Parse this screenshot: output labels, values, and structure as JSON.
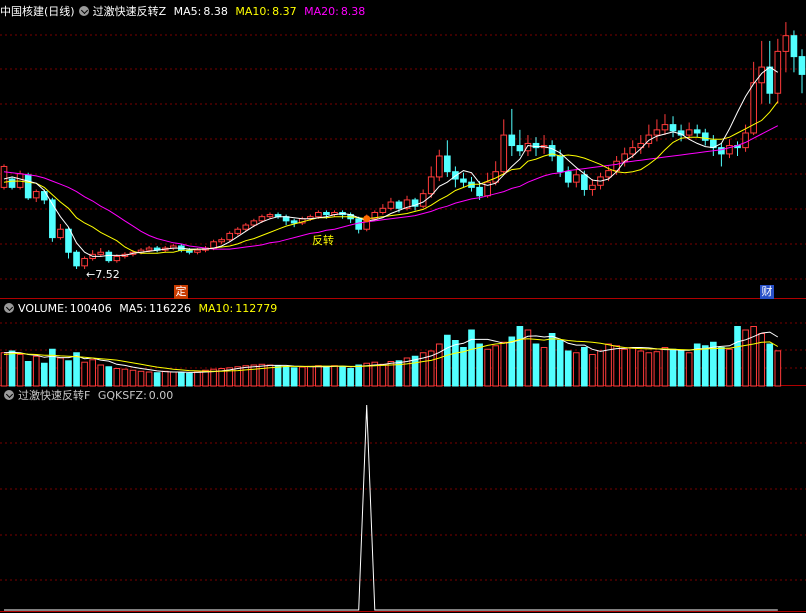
{
  "main_header": {
    "stock": "中国核建",
    "period": "(日线)",
    "indicator": "过激快速反转Z",
    "ma5_label": "MA5:",
    "ma5_value": "8.38",
    "ma10_label": "MA10:",
    "ma10_value": "8.37",
    "ma20_label": "MA20:",
    "ma20_value": "8.38"
  },
  "volume_header": {
    "name": "VOLUME:",
    "value": "100406",
    "ma5_label": "MA5:",
    "ma5_value": "116226",
    "ma10_label": "MA10:",
    "ma10_value": "112779"
  },
  "indicator_header": {
    "name": "过激快速反转F",
    "series": "GQKSFZ:",
    "value": "0.00"
  },
  "annotations": {
    "low_label": "←7.52",
    "signal_label": "反转",
    "tag_left": "定",
    "tag_right": "财"
  },
  "colors": {
    "up": "#ff3b3b",
    "down": "#52ffff",
    "ma5": "#ffffff",
    "ma10": "#ffff00",
    "ma20": "#ff00ff",
    "grid": "#7a0000",
    "separator": "#b00000"
  },
  "chart_data": [
    {
      "type": "candlestick",
      "title": "中国核建 (日线)",
      "ylim": [
        7.3,
        9.9
      ],
      "grid": true,
      "candles": [
        [
          8.3,
          8.5,
          8.28,
          8.52
        ],
        [
          8.38,
          8.3,
          8.28,
          8.4
        ],
        [
          8.3,
          8.43,
          8.28,
          8.46
        ],
        [
          8.42,
          8.2,
          8.18,
          8.44
        ],
        [
          8.2,
          8.26,
          8.16,
          8.28
        ],
        [
          8.26,
          8.18,
          8.14,
          8.28
        ],
        [
          8.18,
          7.82,
          7.78,
          8.2
        ],
        [
          7.82,
          7.9,
          7.8,
          7.95
        ],
        [
          7.9,
          7.68,
          7.62,
          7.92
        ],
        [
          7.68,
          7.55,
          7.52,
          7.7
        ],
        [
          7.55,
          7.62,
          7.52,
          7.64
        ],
        [
          7.62,
          7.66,
          7.6,
          7.7
        ],
        [
          7.66,
          7.68,
          7.64,
          7.72
        ],
        [
          7.68,
          7.6,
          7.58,
          7.7
        ],
        [
          7.6,
          7.64,
          7.58,
          7.66
        ],
        [
          7.64,
          7.66,
          7.62,
          7.68
        ],
        [
          7.66,
          7.68,
          7.64,
          7.7
        ],
        [
          7.68,
          7.7,
          7.66,
          7.72
        ],
        [
          7.7,
          7.72,
          7.68,
          7.74
        ],
        [
          7.72,
          7.7,
          7.68,
          7.74
        ],
        [
          7.7,
          7.72,
          7.68,
          7.74
        ],
        [
          7.72,
          7.74,
          7.7,
          7.76
        ],
        [
          7.74,
          7.7,
          7.68,
          7.76
        ],
        [
          7.7,
          7.68,
          7.66,
          7.72
        ],
        [
          7.68,
          7.7,
          7.66,
          7.72
        ],
        [
          7.7,
          7.72,
          7.68,
          7.74
        ],
        [
          7.72,
          7.78,
          7.7,
          7.8
        ],
        [
          7.78,
          7.8,
          7.76,
          7.82
        ],
        [
          7.8,
          7.86,
          7.78,
          7.88
        ],
        [
          7.86,
          7.9,
          7.84,
          7.92
        ],
        [
          7.9,
          7.94,
          7.88,
          7.96
        ],
        [
          7.94,
          7.98,
          7.92,
          8.0
        ],
        [
          7.98,
          8.02,
          7.96,
          8.04
        ],
        [
          8.02,
          8.04,
          8.0,
          8.06
        ],
        [
          8.04,
          8.02,
          8.0,
          8.06
        ],
        [
          8.02,
          7.98,
          7.94,
          8.04
        ],
        [
          7.98,
          7.96,
          7.92,
          8.0
        ],
        [
          7.96,
          8.0,
          7.94,
          8.02
        ],
        [
          8.0,
          8.02,
          7.98,
          8.04
        ],
        [
          8.02,
          8.06,
          8.0,
          8.08
        ],
        [
          8.06,
          8.04,
          8.0,
          8.08
        ],
        [
          8.04,
          8.06,
          8.02,
          8.08
        ],
        [
          8.06,
          8.04,
          8.0,
          8.08
        ],
        [
          8.04,
          8.0,
          7.96,
          8.06
        ],
        [
          8.0,
          7.9,
          7.86,
          8.02
        ],
        [
          7.9,
          8.0,
          7.88,
          8.04
        ],
        [
          8.0,
          8.06,
          7.98,
          8.08
        ],
        [
          8.06,
          8.1,
          8.04,
          8.14
        ],
        [
          8.1,
          8.16,
          8.08,
          8.2
        ],
        [
          8.16,
          8.1,
          8.06,
          8.18
        ],
        [
          8.1,
          8.18,
          8.08,
          8.22
        ],
        [
          8.18,
          8.12,
          8.08,
          8.2
        ],
        [
          8.12,
          8.24,
          8.1,
          8.28
        ],
        [
          8.24,
          8.4,
          8.2,
          8.5
        ],
        [
          8.4,
          8.6,
          8.36,
          8.66
        ],
        [
          8.6,
          8.45,
          8.4,
          8.75
        ],
        [
          8.45,
          8.38,
          8.3,
          8.5
        ],
        [
          8.38,
          8.35,
          8.3,
          8.44
        ],
        [
          8.35,
          8.3,
          8.26,
          8.4
        ],
        [
          8.3,
          8.22,
          8.18,
          8.36
        ],
        [
          8.22,
          8.35,
          8.2,
          8.44
        ],
        [
          8.35,
          8.45,
          8.32,
          8.55
        ],
        [
          8.45,
          8.8,
          8.42,
          8.95
        ],
        [
          8.8,
          8.7,
          8.6,
          9.05
        ],
        [
          8.7,
          8.65,
          8.6,
          8.85
        ],
        [
          8.65,
          8.72,
          8.6,
          8.8
        ],
        [
          8.72,
          8.68,
          8.6,
          8.78
        ],
        [
          8.68,
          8.7,
          8.62,
          8.8
        ],
        [
          8.7,
          8.6,
          8.55,
          8.75
        ],
        [
          8.6,
          8.45,
          8.4,
          8.66
        ],
        [
          8.45,
          8.35,
          8.3,
          8.5
        ],
        [
          8.35,
          8.42,
          8.3,
          8.48
        ],
        [
          8.42,
          8.28,
          8.22,
          8.46
        ],
        [
          8.28,
          8.32,
          8.22,
          8.38
        ],
        [
          8.32,
          8.4,
          8.28,
          8.44
        ],
        [
          8.4,
          8.46,
          8.36,
          8.5
        ],
        [
          8.46,
          8.55,
          8.42,
          8.6
        ],
        [
          8.55,
          8.62,
          8.5,
          8.68
        ],
        [
          8.62,
          8.68,
          8.58,
          8.75
        ],
        [
          8.68,
          8.72,
          8.62,
          8.8
        ],
        [
          8.72,
          8.8,
          8.68,
          8.9
        ],
        [
          8.8,
          8.85,
          8.74,
          8.95
        ],
        [
          8.85,
          8.9,
          8.8,
          9.0
        ],
        [
          8.9,
          8.84,
          8.78,
          8.98
        ],
        [
          8.84,
          8.8,
          8.74,
          8.9
        ],
        [
          8.8,
          8.85,
          8.76,
          8.92
        ],
        [
          8.85,
          8.82,
          8.78,
          8.9
        ],
        [
          8.82,
          8.75,
          8.7,
          8.86
        ],
        [
          8.75,
          8.68,
          8.6,
          8.8
        ],
        [
          8.68,
          8.62,
          8.5,
          8.72
        ],
        [
          8.62,
          8.7,
          8.58,
          8.76
        ],
        [
          8.7,
          8.68,
          8.6,
          8.74
        ],
        [
          8.68,
          8.82,
          8.64,
          8.9
        ],
        [
          8.82,
          9.3,
          8.8,
          9.5
        ],
        [
          9.3,
          9.45,
          9.1,
          9.7
        ],
        [
          9.45,
          9.2,
          9.1,
          9.7
        ],
        [
          9.2,
          9.6,
          9.1,
          9.72
        ],
        [
          9.6,
          9.75,
          9.4,
          9.88
        ],
        [
          9.75,
          9.55,
          9.4,
          9.8
        ],
        [
          9.55,
          9.38,
          9.2,
          9.62
        ]
      ],
      "ma5": [
        8.38,
        8.4,
        8.38,
        8.36,
        8.34,
        8.27,
        8.14,
        8.02,
        7.92,
        7.77,
        7.68,
        7.64,
        7.64,
        7.65,
        7.65,
        7.65,
        7.67,
        7.68,
        7.69,
        7.7,
        7.71,
        7.72,
        7.72,
        7.71,
        7.71,
        7.71,
        7.72,
        7.74,
        7.78,
        7.83,
        7.88,
        7.93,
        7.97,
        8.0,
        8.02,
        8.02,
        8.01,
        8.0,
        8.0,
        8.01,
        8.02,
        8.04,
        8.05,
        8.04,
        8.01,
        7.98,
        7.99,
        8.01,
        8.05,
        8.08,
        8.11,
        8.13,
        8.16,
        8.22,
        8.31,
        8.35,
        8.41,
        8.46,
        8.44,
        8.34,
        8.32,
        8.34,
        8.42,
        8.5,
        8.57,
        8.7,
        8.69,
        8.69,
        8.67,
        8.63,
        8.56,
        8.49,
        8.43,
        8.37,
        8.36,
        8.38,
        8.45,
        8.55,
        8.6,
        8.67,
        8.75,
        8.79,
        8.81,
        8.83,
        8.81,
        8.76,
        8.72,
        8.69,
        8.68,
        8.72,
        8.86,
        9.02,
        9.17,
        9.29,
        9.39,
        9.45,
        9.4
      ],
      "ma10": [
        8.35,
        8.36,
        8.36,
        8.35,
        8.34,
        8.3,
        8.23,
        8.16,
        8.1,
        8.01,
        7.96,
        7.92,
        7.87,
        7.83,
        7.79,
        7.73,
        7.69,
        7.67,
        7.67,
        7.67,
        7.68,
        7.68,
        7.7,
        7.7,
        7.71,
        7.71,
        7.72,
        7.73,
        7.74,
        7.76,
        7.79,
        7.81,
        7.84,
        7.87,
        7.9,
        7.93,
        7.95,
        7.97,
        7.99,
        8.01,
        8.01,
        8.02,
        8.02,
        8.02,
        8.01,
        8.0,
        8.01,
        8.02,
        8.03,
        8.04,
        8.05,
        8.07,
        8.09,
        8.13,
        8.18,
        8.22,
        8.27,
        8.3,
        8.33,
        8.33,
        8.36,
        8.39,
        8.43,
        8.47,
        8.48,
        8.55,
        8.57,
        8.6,
        8.62,
        8.6,
        8.61,
        8.6,
        8.58,
        8.55,
        8.52,
        8.48,
        8.45,
        8.44,
        8.45,
        8.47,
        8.52,
        8.58,
        8.66,
        8.73,
        8.77,
        8.78,
        8.78,
        8.77,
        8.76,
        8.76,
        8.78,
        8.82,
        8.86,
        8.9,
        8.94,
        9.02,
        9.12
      ],
      "ma20": [
        8.45,
        8.44,
        8.43,
        8.42,
        8.41,
        8.39,
        8.36,
        8.33,
        8.3,
        8.26,
        8.21,
        8.17,
        8.12,
        8.08,
        8.03,
        7.98,
        7.93,
        7.88,
        7.84,
        7.81,
        7.79,
        7.77,
        7.76,
        7.74,
        7.73,
        7.72,
        7.71,
        7.71,
        7.71,
        7.72,
        7.73,
        7.74,
        7.75,
        7.77,
        7.78,
        7.8,
        7.82,
        7.84,
        7.86,
        7.87,
        7.89,
        7.9,
        7.92,
        7.94,
        7.96,
        7.97,
        7.98,
        7.99,
        8.0,
        8.01,
        8.02,
        8.03,
        8.05,
        8.07,
        8.1,
        8.12,
        8.15,
        8.17,
        8.19,
        8.2,
        8.22,
        8.24,
        8.26,
        8.29,
        8.31,
        8.35,
        8.38,
        8.41,
        8.43,
        8.44,
        8.46,
        8.47,
        8.48,
        8.49,
        8.5,
        8.51,
        8.52,
        8.54,
        8.55,
        8.56,
        8.57,
        8.58,
        8.59,
        8.6,
        8.61,
        8.62,
        8.63,
        8.64,
        8.65,
        8.66,
        8.68,
        8.7,
        8.73,
        8.77,
        8.81,
        8.85,
        8.89
      ]
    },
    {
      "type": "bar",
      "title": "VOLUME",
      "ylim": [
        0,
        200000
      ],
      "values": [
        95000,
        100000,
        90000,
        70000,
        85000,
        65000,
        105000,
        80000,
        72000,
        95000,
        68000,
        75000,
        60000,
        55000,
        50000,
        48000,
        45000,
        42000,
        40000,
        38000,
        42000,
        40000,
        38000,
        36000,
        40000,
        45000,
        48000,
        50000,
        52000,
        55000,
        58000,
        60000,
        62000,
        60000,
        58000,
        55000,
        52000,
        54000,
        56000,
        58000,
        56000,
        58000,
        55000,
        50000,
        60000,
        65000,
        68000,
        62000,
        70000,
        72000,
        80000,
        85000,
        95000,
        100000,
        120000,
        145000,
        130000,
        110000,
        160000,
        120000,
        105000,
        115000,
        125000,
        140000,
        170000,
        160000,
        120000,
        110000,
        150000,
        130000,
        100000,
        95000,
        110000,
        90000,
        100000,
        120000,
        115000,
        105000,
        110000,
        100000,
        95000,
        98000,
        110000,
        105000,
        100000,
        95000,
        120000,
        115000,
        125000,
        110000,
        105000,
        170000,
        160000,
        170000,
        150000,
        120000,
        100406
      ],
      "ma5": [
        95000,
        96000,
        95000,
        90000,
        88000,
        82000,
        85000,
        81000,
        81000,
        86000,
        78000,
        80000,
        74000,
        71000,
        62000,
        59000,
        54000,
        50000,
        47000,
        43000,
        41000,
        40000,
        40000,
        39000,
        39000,
        40000,
        41000,
        43000,
        46000,
        50000,
        53000,
        55000,
        57000,
        59000,
        59000,
        59000,
        57000,
        56000,
        55000,
        55000,
        55000,
        56000,
        57000,
        55000,
        56000,
        58000,
        60000,
        61000,
        65000,
        67000,
        70000,
        75000,
        80000,
        86000,
        96000,
        109000,
        118000,
        122000,
        133000,
        133000,
        133000,
        128000,
        122000,
        125000,
        132000,
        142000,
        143000,
        140000,
        142000,
        134000,
        122000,
        117000,
        117000,
        105000,
        99000,
        103000,
        107000,
        108000,
        110000,
        110000,
        109000,
        106000,
        104000,
        104000,
        102000,
        102000,
        106000,
        107000,
        111000,
        113000,
        115000,
        126000,
        132000,
        141000,
        151000,
        154000,
        140000
      ],
      "ma10": [
        90000,
        92000,
        93000,
        91000,
        90000,
        88000,
        88000,
        86000,
        85000,
        84000,
        82000,
        80000,
        78000,
        76000,
        74000,
        70000,
        66000,
        62000,
        58000,
        54000,
        51000,
        48000,
        46000,
        44000,
        43000,
        42000,
        42000,
        42000,
        43000,
        44000,
        46000,
        48000,
        50000,
        52000,
        54000,
        56000,
        56000,
        56000,
        56000,
        57000,
        57000,
        57000,
        57000,
        56000,
        56000,
        57000,
        58000,
        59000,
        60000,
        61000,
        63000,
        66000,
        70000,
        73000,
        80000,
        88000,
        94000,
        98000,
        105000,
        110000,
        116000,
        120000,
        122000,
        127000,
        133000,
        135000,
        133000,
        131000,
        135000,
        133000,
        130000,
        128000,
        127000,
        125000,
        122000,
        118000,
        113000,
        110000,
        108000,
        107000,
        106000,
        106000,
        106000,
        105000,
        104000,
        103000,
        104000,
        106000,
        107000,
        108000,
        108000,
        112000,
        116000,
        120000,
        125000,
        126000,
        112779
      ]
    },
    {
      "type": "line",
      "title": "过激快速反转F",
      "series": [
        {
          "name": "GQKSFZ",
          "values": [
            0,
            0,
            0,
            0,
            0,
            0,
            0,
            0,
            0,
            0,
            0,
            0,
            0,
            0,
            0,
            0,
            0,
            0,
            0,
            0,
            0,
            0,
            0,
            0,
            0,
            0,
            0,
            0,
            0,
            0,
            0,
            0,
            0,
            0,
            0,
            0,
            0,
            0,
            0,
            0,
            0,
            0,
            0,
            0,
            0,
            1,
            0,
            0,
            0,
            0,
            0,
            0,
            0,
            0,
            0,
            0,
            0,
            0,
            0,
            0,
            0,
            0,
            0,
            0,
            0,
            0,
            0,
            0,
            0,
            0,
            0,
            0,
            0,
            0,
            0,
            0,
            0,
            0,
            0,
            0,
            0,
            0,
            0,
            0,
            0,
            0,
            0,
            0,
            0,
            0,
            0,
            0,
            0,
            0,
            0,
            0,
            0
          ]
        }
      ],
      "ylim": [
        0,
        1
      ]
    }
  ]
}
